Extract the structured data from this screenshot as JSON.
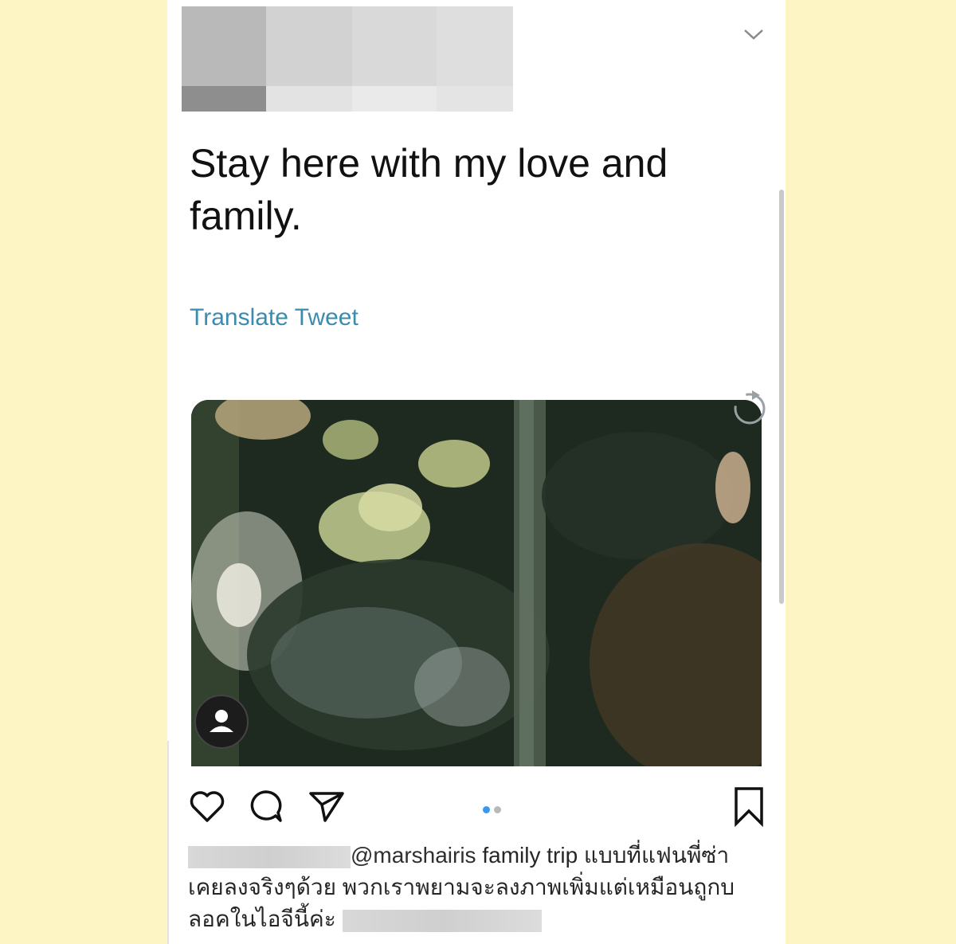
{
  "tweet": {
    "text_line1": "Stay here with my love and",
    "text_line2": "family.",
    "translate_label": "Translate Tweet"
  },
  "icons": {
    "menu": "chevron-down-icon",
    "retweet": "retweet-icon",
    "user_tag": "user-tag-icon",
    "like": "heart-icon",
    "comment": "comment-icon",
    "share": "send-icon",
    "save": "bookmark-icon"
  },
  "carousel": {
    "total_slides": 2,
    "active_slide": 1
  },
  "caption": {
    "mention": "@marshairis",
    "line1_rest": " family trip แบบที่แฟนพี่ซ่า",
    "line2": "เคยลงจริงๆด้วย พวกเราพยามจะลงภาพเพิ่มแต่เหมือนถูกบ",
    "line3": "ลอคในไอจีนี้ค่ะ"
  },
  "colors": {
    "background": "#fdf6c4",
    "link": "#3a8bb0",
    "active_dot": "#3897f0"
  }
}
